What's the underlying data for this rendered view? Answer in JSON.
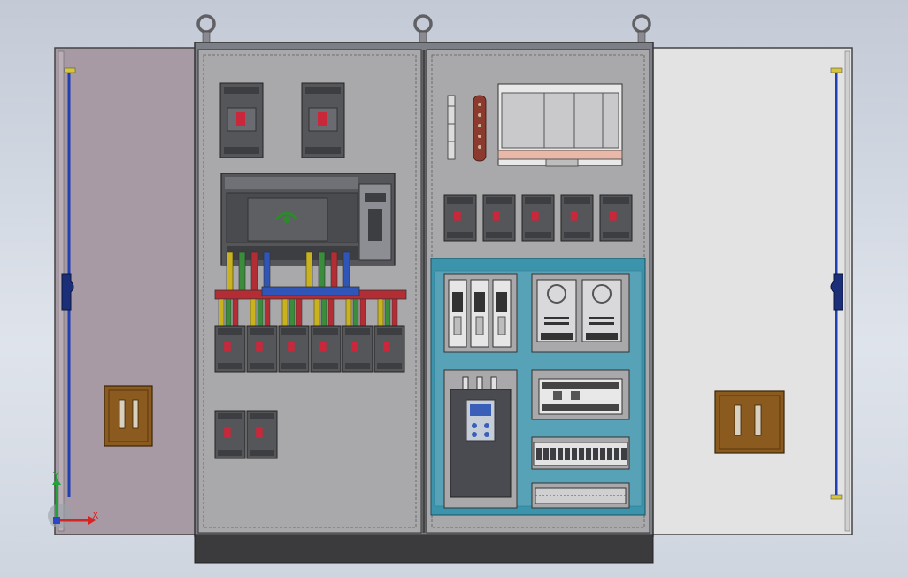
{
  "axes": {
    "x_label": "X",
    "y_label": "Y"
  },
  "colors": {
    "background": "#d4dae3",
    "left_door": "#a89aa4",
    "right_door": "#e3e3e3",
    "panel": "#a9a9ab",
    "cabinet_frame": "#7d7f86",
    "plinth": "#3b3b3d",
    "din_rail_frame": "#3b94ab",
    "breaker_body": "#55565a",
    "breaker_red": "#c8283a",
    "busbar_red": "#b52d34",
    "busbar_blue": "#2f55b8",
    "busbar_yellow": "#c9b21e",
    "busbar_green": "#3b8c3b",
    "handle_brown": "#8b5a1e",
    "door_rod": "#1f3fb5",
    "axis_x": "#d62424",
    "axis_y": "#24a13a",
    "axis_z": "#2b46c8"
  },
  "components": {
    "main_breakers": 2,
    "plc_units": 1,
    "busbar_taps": 6,
    "branch_breakers": 6,
    "aux_breakers": 2,
    "right_breakers": 5,
    "fuse_holders": 3,
    "power_supplies": 2,
    "terminal_blocks": 13
  },
  "icons": {
    "lifting_eye": "lifting-eye-icon",
    "axis_triad": "xyz-axis-icon",
    "door_lock": "door-lock-icon"
  }
}
